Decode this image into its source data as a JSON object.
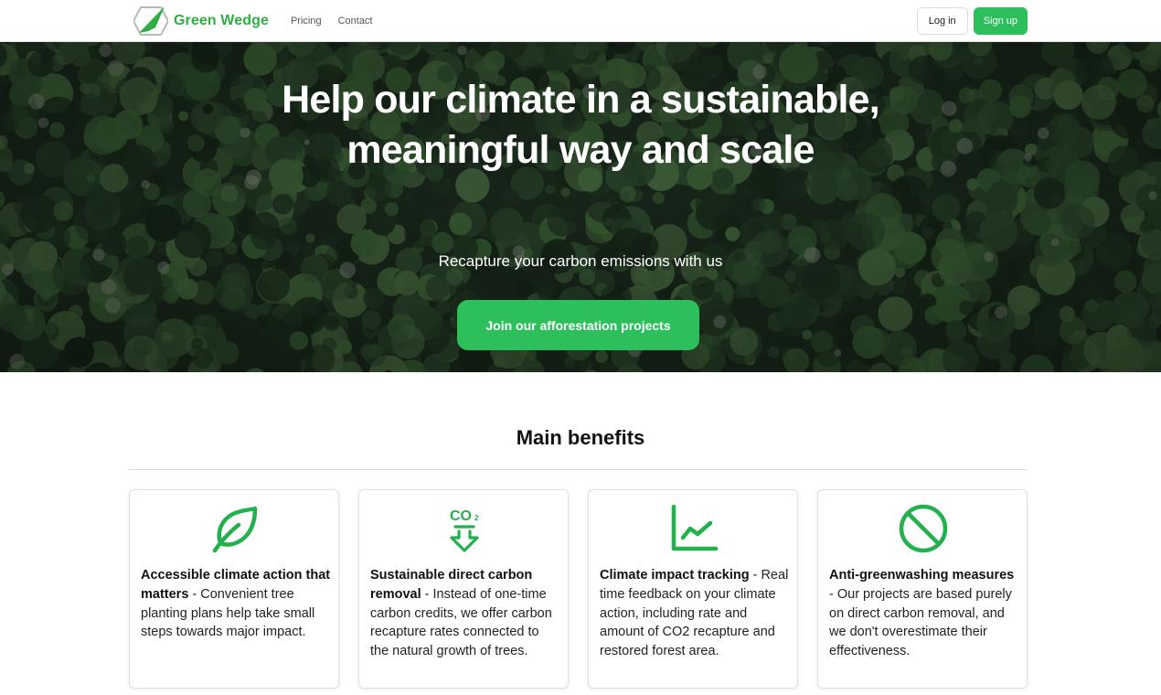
{
  "nav": {
    "brand": "Green Wedge",
    "links": [
      "Pricing",
      "Contact"
    ],
    "login": "Log in",
    "signup": "Sign up"
  },
  "hero": {
    "title": "Help our climate in a sustainable, meaningful way and scale",
    "subtitle": "Recapture your carbon emissions with us",
    "cta": "Join our afforestation projects"
  },
  "benefits": {
    "title": "Main benefits",
    "items": [
      {
        "icon": "leaf-icon",
        "title": "Accessible climate action that matters",
        "text": " - Convenient tree planting plans help take small steps towards major impact."
      },
      {
        "icon": "co2-down-icon",
        "title": "Sustainable direct carbon removal",
        "text": " - Instead of one-time carbon credits, we offer carbon recapture rates connected to the natural growth of trees."
      },
      {
        "icon": "line-chart-icon",
        "title": "Climate impact tracking",
        "text": " - Real time feedback on your climate action, including rate and amount of CO2 recapture and restored forest area."
      },
      {
        "icon": "ban-icon",
        "title": "Anti-greenwashing measures",
        "text": " - Our projects are based purely on direct carbon removal, and we don't overestimate their effectiveness."
      }
    ]
  },
  "colors": {
    "brand_green": "#2fae44",
    "button_green": "#2dbf5c",
    "icon_green": "#22b14c"
  }
}
